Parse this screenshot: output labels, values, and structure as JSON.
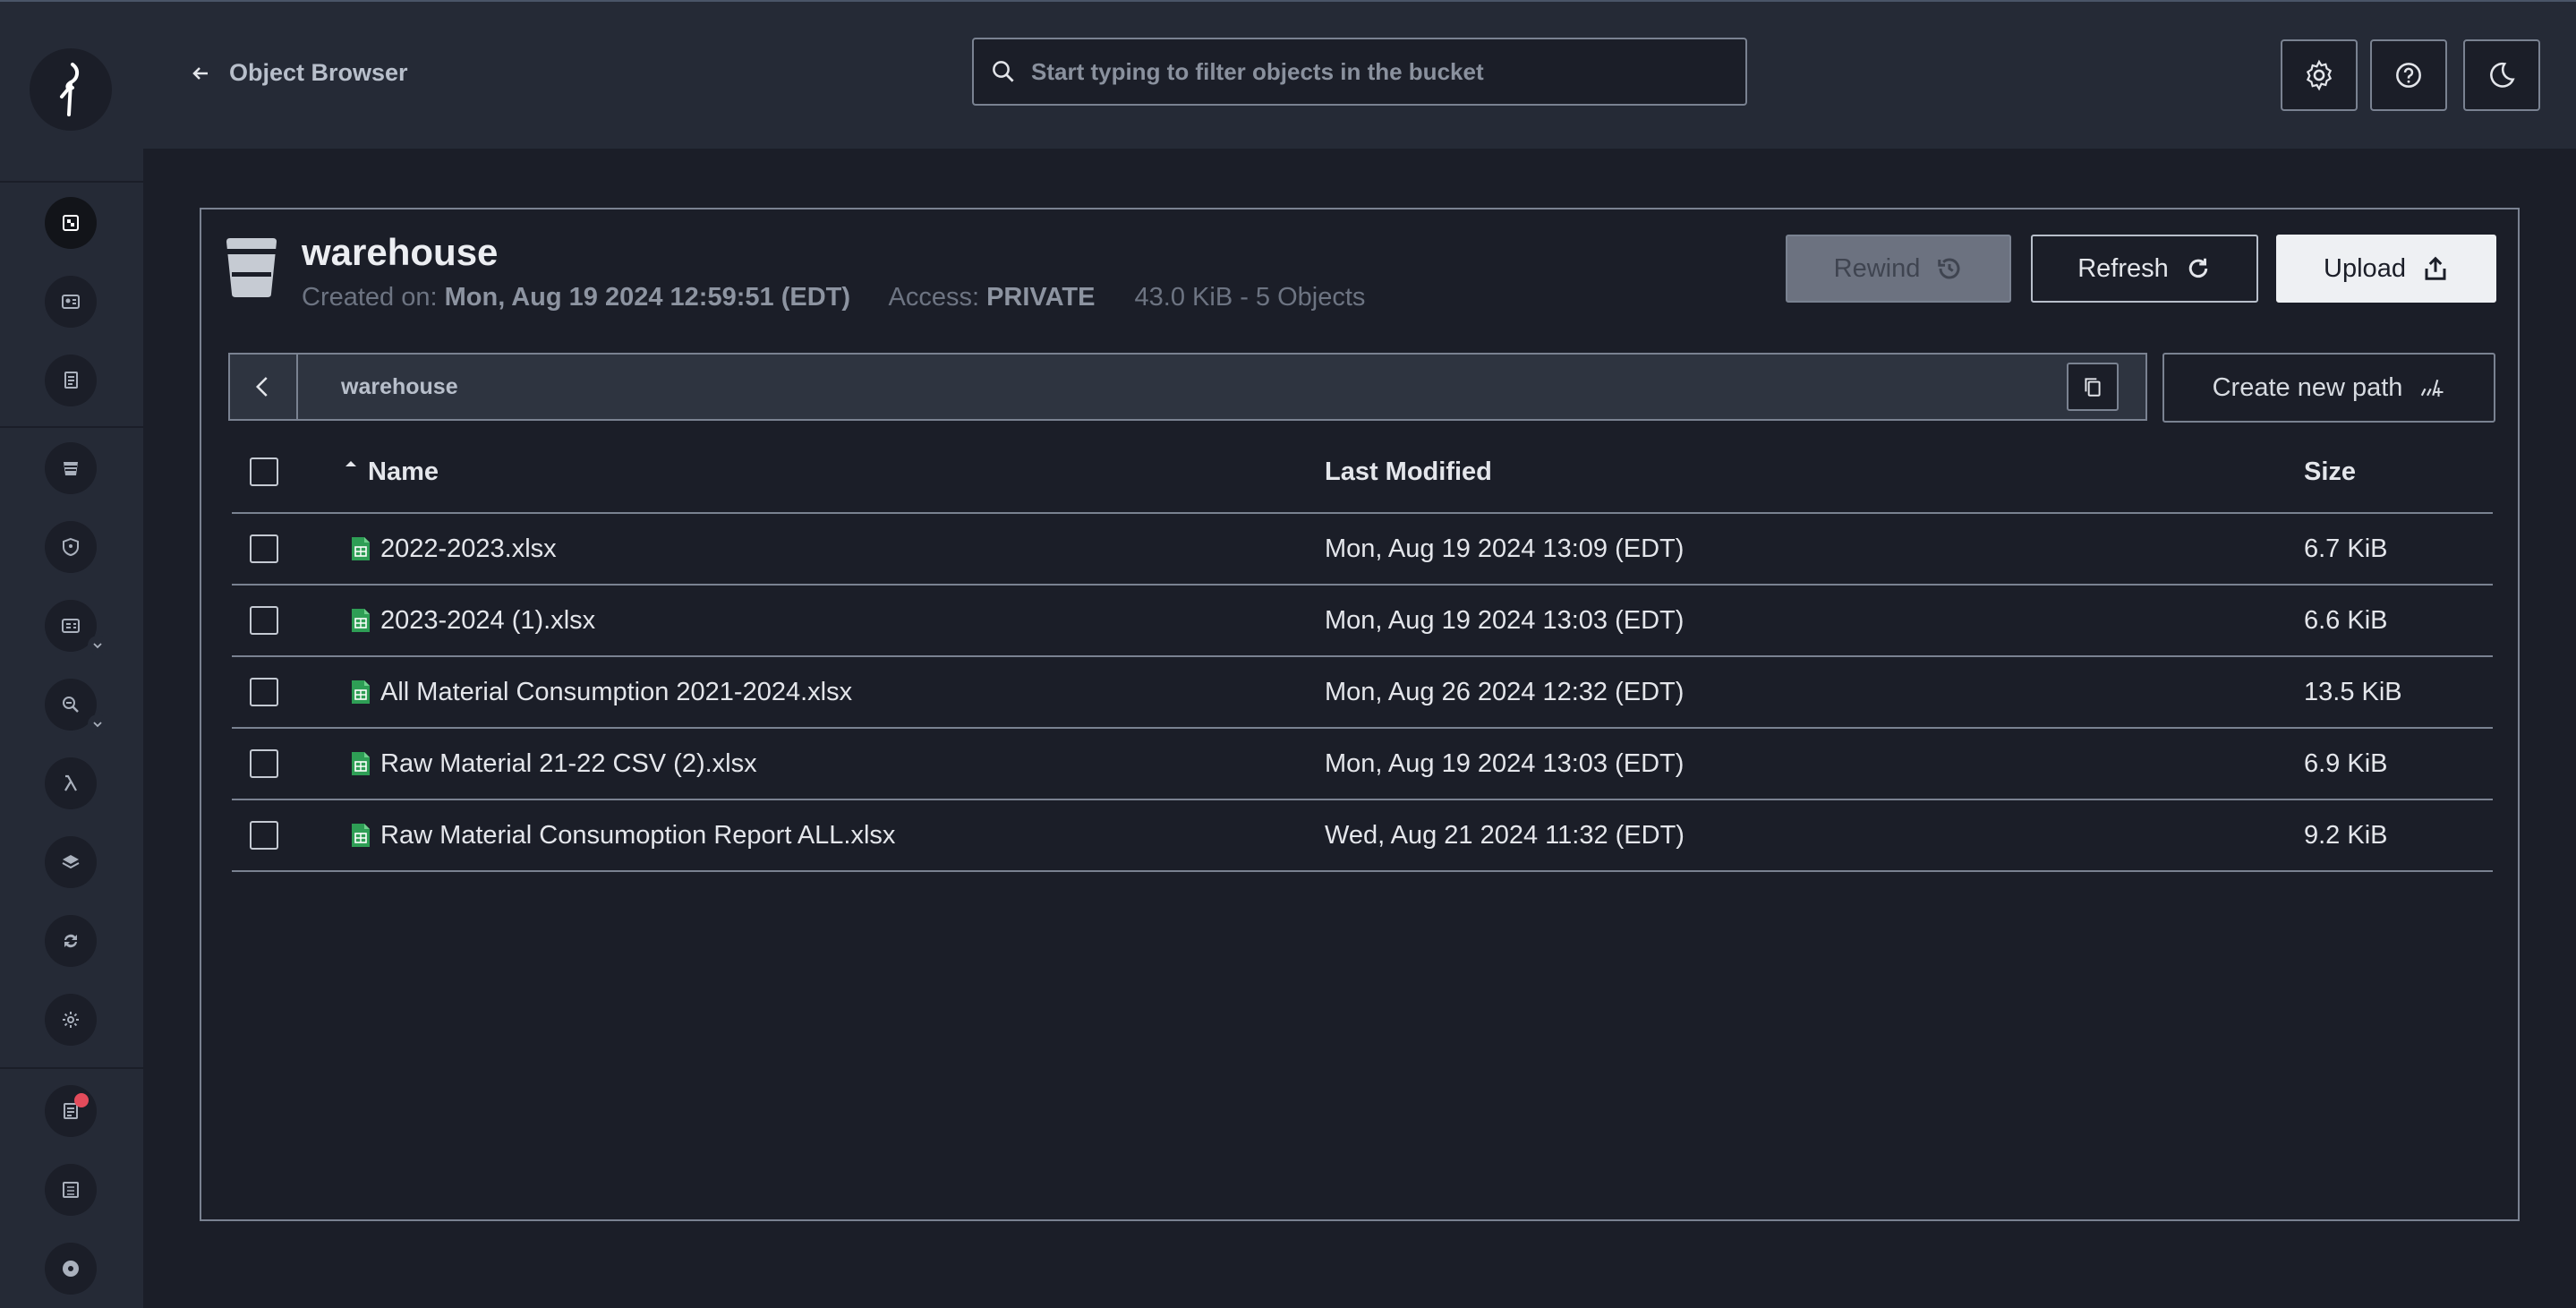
{
  "header": {
    "back_title": "Object Browser",
    "search_placeholder": "Start typing to filter objects in the bucket"
  },
  "sidebar": {
    "items": [
      {
        "name": "object-browser",
        "icon": "object-browser-icon",
        "active": true
      },
      {
        "name": "access-keys",
        "icon": "access-keys-icon"
      },
      {
        "name": "documentation",
        "icon": "document-icon"
      },
      {
        "name": "buckets",
        "icon": "bucket-icon"
      },
      {
        "name": "policies",
        "icon": "shield-icon"
      },
      {
        "name": "identity",
        "icon": "id-card-icon",
        "expandable": true
      },
      {
        "name": "monitoring",
        "icon": "monitor-search-icon",
        "expandable": true
      },
      {
        "name": "events",
        "icon": "lambda-icon"
      },
      {
        "name": "tiering",
        "icon": "layers-icon"
      },
      {
        "name": "site-replication",
        "icon": "sync-icon"
      },
      {
        "name": "configuration",
        "icon": "gear-icon"
      },
      {
        "name": "license",
        "icon": "license-icon",
        "notification": true
      },
      {
        "name": "health",
        "icon": "health-icon"
      },
      {
        "name": "profile",
        "icon": "profile-icon"
      }
    ]
  },
  "bucket": {
    "name": "warehouse",
    "created_label": "Created on:",
    "created_value": "Mon, Aug 19 2024 12:59:51 (EDT)",
    "access_label": "Access:",
    "access_value": "PRIVATE",
    "summary": "43.0 KiB - 5 Objects"
  },
  "actions": {
    "rewind": "Rewind",
    "refresh": "Refresh",
    "upload": "Upload",
    "create_path": "Create new path"
  },
  "breadcrumb": {
    "path": "warehouse"
  },
  "table": {
    "columns": {
      "name": "Name",
      "modified": "Last Modified",
      "size": "Size"
    },
    "rows": [
      {
        "name": "2022-2023.xlsx",
        "modified": "Mon, Aug 19 2024 13:09 (EDT)",
        "size": "6.7 KiB"
      },
      {
        "name": "2023-2024 (1).xlsx",
        "modified": "Mon, Aug 19 2024 13:03 (EDT)",
        "size": "6.6 KiB"
      },
      {
        "name": "All Material Consumption 2021-2024.xlsx",
        "modified": "Mon, Aug 26 2024 12:32 (EDT)",
        "size": "13.5 KiB"
      },
      {
        "name": "Raw Material 21-22 CSV (2).xlsx",
        "modified": "Mon, Aug 19 2024 13:03 (EDT)",
        "size": "6.9 KiB"
      },
      {
        "name": "Raw Material Consumoption Report ALL.xlsx",
        "modified": "Wed, Aug 21 2024 11:32 (EDT)",
        "size": "9.2 KiB"
      }
    ]
  },
  "colors": {
    "background": "#1b1e28",
    "panel": "#252a36",
    "border": "#7a8291",
    "xlsx_icon": "#2e9e55",
    "notification": "#e34b5b"
  }
}
